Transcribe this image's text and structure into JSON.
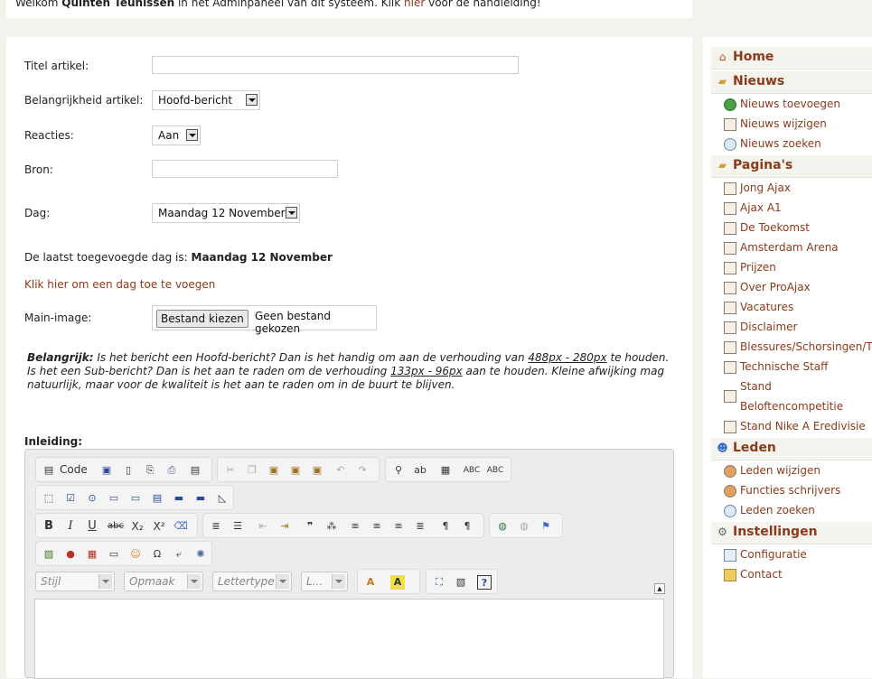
{
  "header": {
    "welcome_prefix": "Welkom ",
    "user_name": "Quinten Teunissen",
    "welcome_middle": " in het Adminpaneel van dit systeem. Klik ",
    "link_text": "hier",
    "welcome_suffix": " voor de handleiding!"
  },
  "form": {
    "title_label": "Titel artikel:",
    "title_value": "",
    "importance_label": "Belangrijkheid artikel:",
    "importance_value": "Hoofd-bericht",
    "reactions_label": "Reacties:",
    "reactions_value": "Aan",
    "source_label": "Bron:",
    "source_value": "",
    "day_label": "Dag:",
    "day_value": "Maandag 12 November",
    "last_day_text": "De laatst toegevoegde dag is: ",
    "last_day_value": "Maandag 12 November",
    "add_day_link": "Klik hier om een dag toe te voegen",
    "main_image_label": "Main-image:",
    "file_button": "Bestand kiezen",
    "file_status": "Geen bestand gekozen",
    "note_bold": "Belangrijk:",
    "note_part1": " Is het bericht een Hoofd-bericht? Dan is het handig om aan de verhouding van ",
    "note_ratio1": "488px - 280px",
    "note_part2": " te houden. Is het een Sub-bericht? Dan is het aan te raden om de verhouding ",
    "note_ratio2": "133px - 96px",
    "note_part3": " aan te houden. Kleine afwijking mag natuurlijk, maar voor de kwaliteit is het aan te raden om in de buurt te blijven.",
    "intro_label": "Inleiding:"
  },
  "editor": {
    "code_label": "Code",
    "combos": [
      "Stijl",
      "Opmaak",
      "Lettertype",
      "L..."
    ],
    "bold": "B",
    "italic": "I",
    "underline": "U",
    "strike": "abc",
    "subscript": "X₂",
    "superscript": "X²",
    "spellcheck1": "ABC",
    "spellcheck2": "ABC",
    "font_color": "A",
    "bg_color": "A",
    "help": "?",
    "quote": "❞"
  },
  "sidebar": {
    "sections": [
      {
        "title": "Home",
        "icon": "home-icon",
        "items": []
      },
      {
        "title": "Nieuws",
        "icon": "folder-icon",
        "items": [
          {
            "label": "Nieuws toevoegen",
            "icon": "add-icon"
          },
          {
            "label": "Nieuws wijzigen",
            "icon": "page-icon"
          },
          {
            "label": "Nieuws zoeken",
            "icon": "search-icon"
          }
        ]
      },
      {
        "title": "Pagina's",
        "icon": "folder-icon",
        "items": [
          {
            "label": "Jong Ajax",
            "icon": "page-icon"
          },
          {
            "label": "Ajax A1",
            "icon": "page-icon"
          },
          {
            "label": "De Toekomst",
            "icon": "page-icon"
          },
          {
            "label": "Amsterdam Arena",
            "icon": "page-icon"
          },
          {
            "label": "Prijzen",
            "icon": "page-icon"
          },
          {
            "label": "Over ProAjax",
            "icon": "page-icon"
          },
          {
            "label": "Vacatures",
            "icon": "page-icon"
          },
          {
            "label": "Disclaimer",
            "icon": "page-icon"
          },
          {
            "label": "Blessures/Schorsingen/Tra",
            "icon": "page-icon"
          },
          {
            "label": "Technische Staff",
            "icon": "page-icon"
          },
          {
            "label": "Stand",
            "label2": "Beloftencompetitie",
            "icon": "page-icon"
          },
          {
            "label": "Stand Nike A Eredivisie",
            "icon": "page-icon"
          }
        ]
      },
      {
        "title": "Leden",
        "icon": "user-icon",
        "items": [
          {
            "label": "Leden wijzigen",
            "icon": "users-icon"
          },
          {
            "label": "Functies schrijvers",
            "icon": "users-icon"
          },
          {
            "label": "Leden zoeken",
            "icon": "search-icon"
          }
        ]
      },
      {
        "title": "Instellingen",
        "icon": "gear-icon",
        "items": [
          {
            "label": "Configuratie",
            "icon": "config-icon"
          },
          {
            "label": "Contact",
            "icon": "folder-icon"
          }
        ]
      }
    ]
  }
}
